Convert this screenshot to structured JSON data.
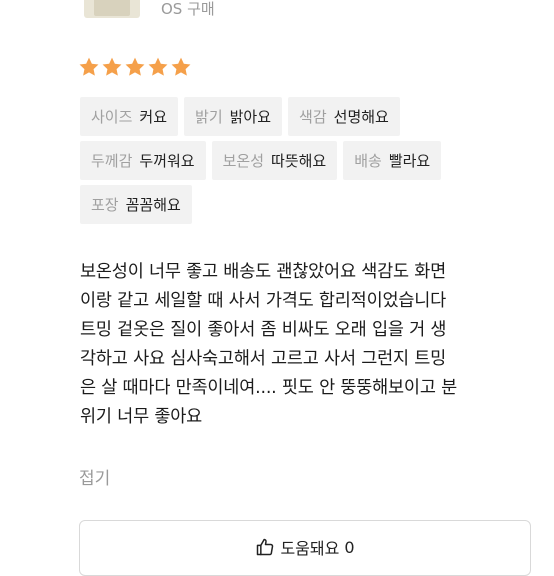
{
  "product": {
    "purchase_option": "OS 구매"
  },
  "rating": {
    "stars": 5,
    "max": 5,
    "color": "#f5a04a"
  },
  "attributes": [
    [
      {
        "key": "사이즈",
        "value": "커요"
      },
      {
        "key": "밝기",
        "value": "밝아요"
      },
      {
        "key": "색감",
        "value": "선명해요"
      }
    ],
    [
      {
        "key": "두께감",
        "value": "두꺼워요"
      },
      {
        "key": "보온성",
        "value": "따뜻해요"
      },
      {
        "key": "배송",
        "value": "빨라요"
      }
    ],
    [
      {
        "key": "포장",
        "value": "꼼꼼해요"
      }
    ]
  ],
  "review": {
    "lines": [
      "보온성이 너무 좋고 배송도 괜찮았어요 색감도 화면",
      "이랑 같고 세일할 때 사서 가격도 합리적이었습니다",
      "트밍 겉옷은 질이 좋아서 좀 비싸도 오래 입을 거 생",
      "각하고 사요 심사숙고해서 고르고 사서 그런지 트밍",
      "은 살 때마다 만족이네여.... 핏도 안 뚱뚱해보이고 분",
      "위기 너무 좋아요"
    ],
    "fold_label": "접기"
  },
  "helpful": {
    "label": "도움돼요",
    "count": "0"
  }
}
